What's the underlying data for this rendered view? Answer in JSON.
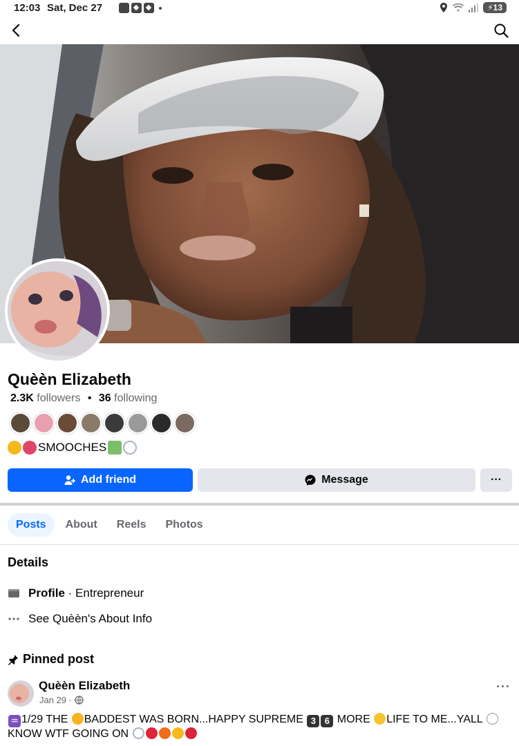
{
  "status_bar": {
    "time": "12:03",
    "date": "Sat, Dec 27",
    "battery": "13"
  },
  "nav": {
    "back_icon": "chevron-left-icon",
    "search_icon": "search-icon"
  },
  "profile": {
    "name": "Quèèn Elizabeth",
    "followers_count": "2.3K",
    "followers_label": "followers",
    "following_count": "36",
    "following_label": "following",
    "bio_text": "SMOOCHES",
    "friend_avatar_colors": [
      "#5a4a3a",
      "#e8a0b0",
      "#6b4a38",
      "#8a7a6a",
      "#3a3a3a",
      "#9a9a9a",
      "#2a2a2a",
      "#7a6a60"
    ]
  },
  "actions": {
    "add_friend": "Add friend",
    "message": "Message",
    "more": "···"
  },
  "tabs": [
    {
      "label": "Posts",
      "active": true
    },
    {
      "label": "About",
      "active": false
    },
    {
      "label": "Reels",
      "active": false
    },
    {
      "label": "Photos",
      "active": false
    }
  ],
  "details": {
    "title": "Details",
    "profile_label": "Profile",
    "profile_value": "· Entrepreneur",
    "about_link": "See Quèèn's About Info"
  },
  "pinned": {
    "title": "Pinned post",
    "author": "Quèèn Elizabeth",
    "date": "Jan 29 ·",
    "more": "···",
    "text_part1": "1/29 THE ",
    "text_part2": "BADDEST WAS BORN...HAPPY SUPREME ",
    "keycap1": "3",
    "keycap2": "6",
    "text_part3": " MORE ",
    "text_part4": "LIFE TO ME...YALL ",
    "text_part5": "KNOW WTF GOING ON "
  },
  "colors": {
    "accent": "#0866ff",
    "secondary_button": "#e4e6eb",
    "muted_text": "#65676b"
  }
}
